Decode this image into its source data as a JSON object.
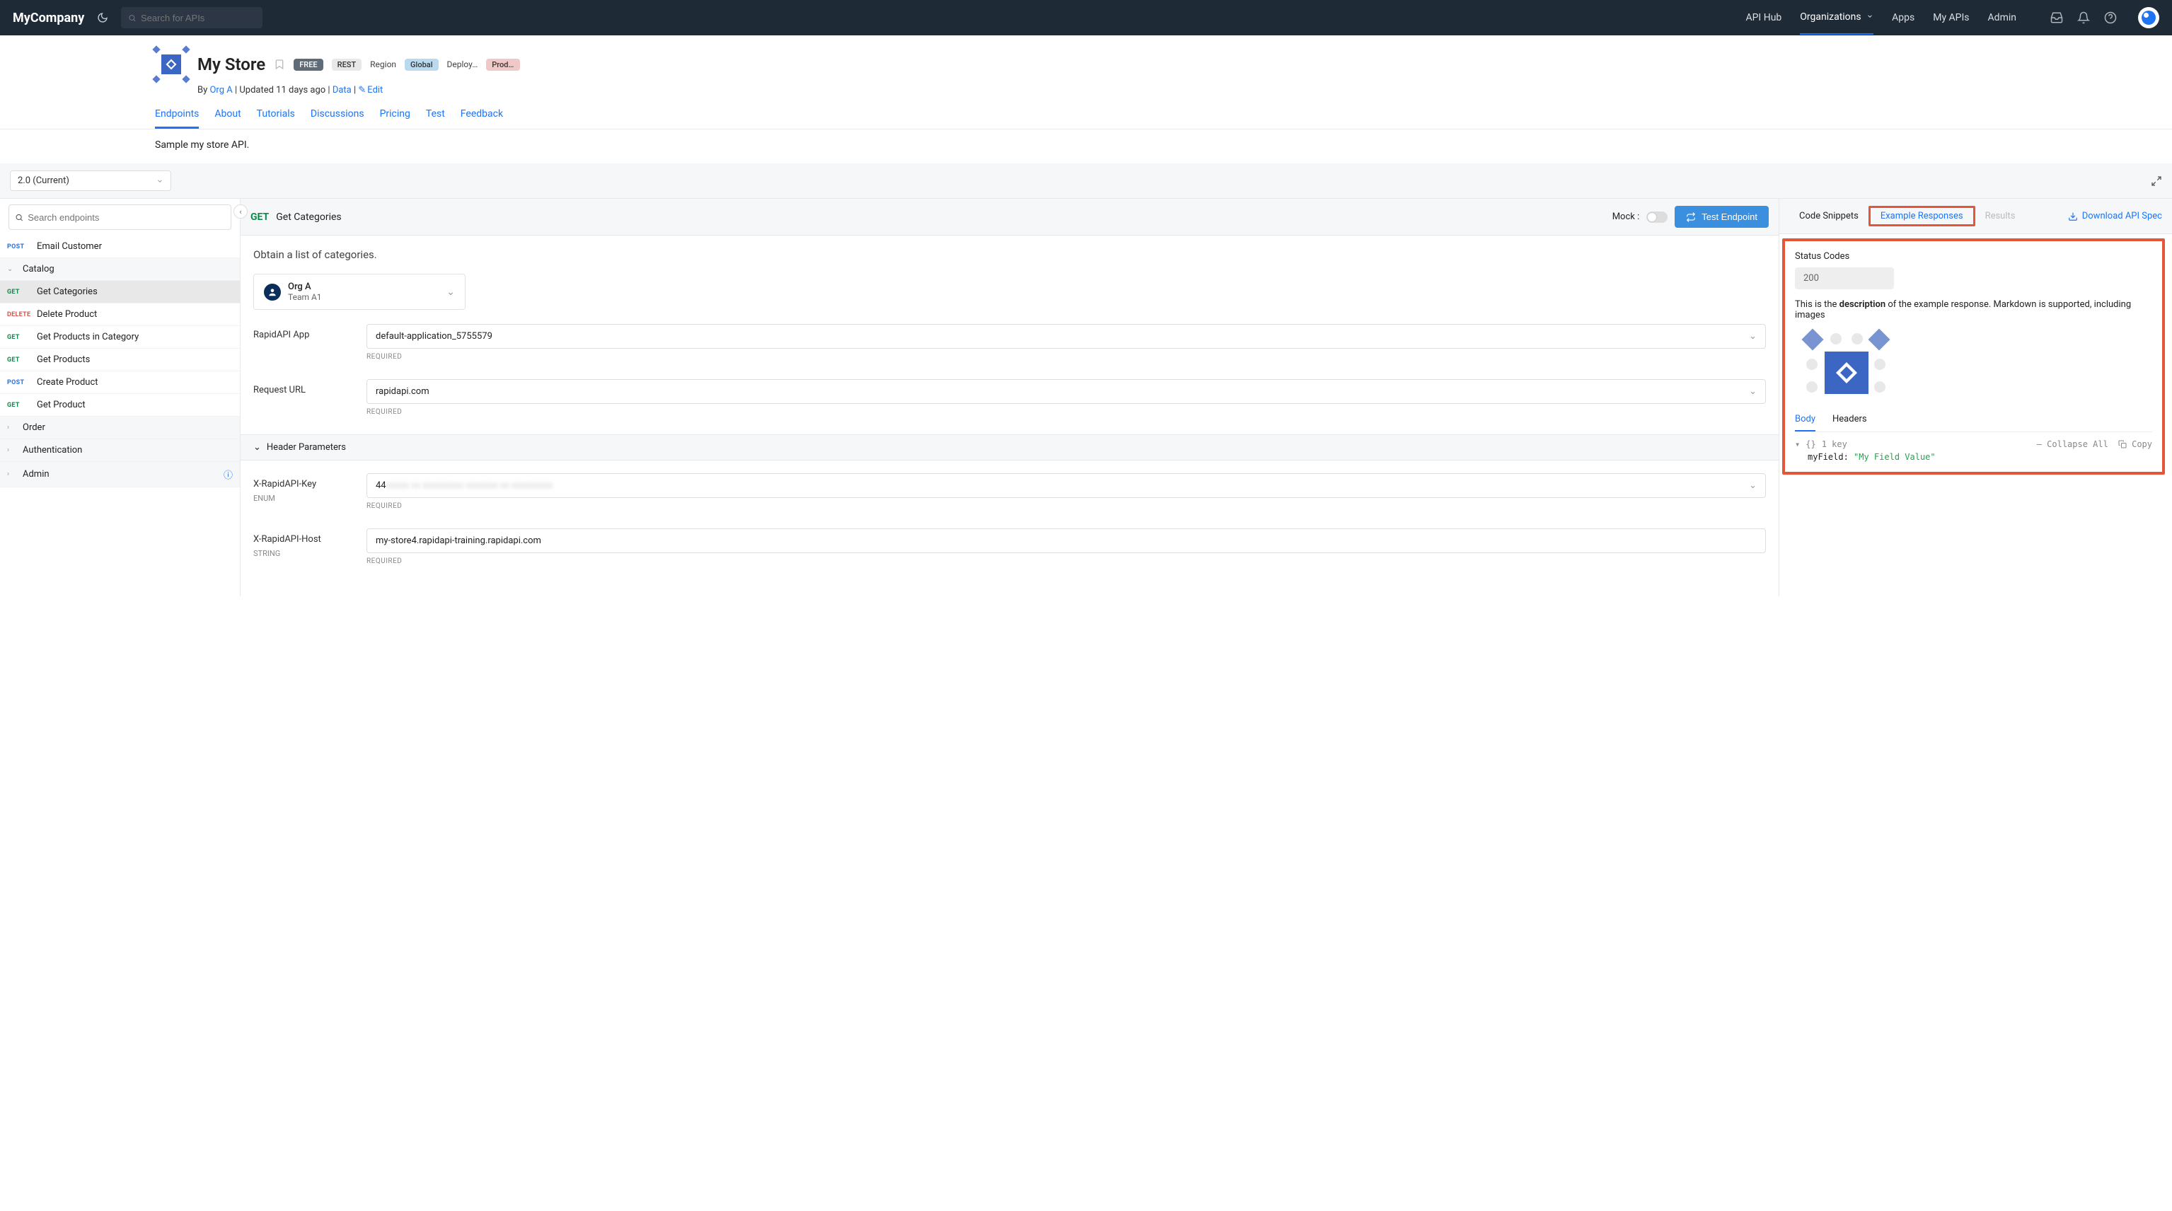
{
  "brand": "MyCompany",
  "search": {
    "placeholder": "Search for APIs"
  },
  "nav": {
    "api_hub": "API Hub",
    "orgs": "Organizations",
    "apps": "Apps",
    "my_apis": "My APIs",
    "admin": "Admin"
  },
  "api": {
    "title": "My Store",
    "badge_free": "FREE",
    "badge_rest": "REST",
    "region_label": "Region",
    "badge_global": "Global",
    "deploy_label": "Deploy…",
    "badge_prod": "Produc…",
    "by_prefix": "By ",
    "org": "Org A",
    "updated": " | Updated 11 days ago | ",
    "data": "Data",
    "edit": "Edit",
    "description": "Sample my store API."
  },
  "tabs": {
    "endpoints": "Endpoints",
    "about": "About",
    "tutorials": "Tutorials",
    "discussions": "Discussions",
    "pricing": "Pricing",
    "test": "Test",
    "feedback": "Feedback"
  },
  "toolbar": {
    "version": "2.0 (Current)"
  },
  "left": {
    "search_placeholder": "Search endpoints",
    "items": [
      {
        "method": "POST",
        "name": "Email Customer"
      },
      {
        "group": true,
        "name": "Catalog",
        "open": true
      },
      {
        "method": "GET",
        "name": "Get Categories",
        "active": true
      },
      {
        "method": "DELETE",
        "name": "Delete Product"
      },
      {
        "method": "GET",
        "name": "Get Products in Category"
      },
      {
        "method": "GET",
        "name": "Get Products"
      },
      {
        "method": "POST",
        "name": "Create Product"
      },
      {
        "method": "GET",
        "name": "Get Product"
      },
      {
        "group": true,
        "name": "Order"
      },
      {
        "group": true,
        "name": "Authentication"
      },
      {
        "group": true,
        "name": "Admin",
        "info": true
      }
    ]
  },
  "mid": {
    "method": "GET",
    "title": "Get Categories",
    "mock_label": "Mock :",
    "test_btn": "Test Endpoint",
    "desc": "Obtain a list of categories.",
    "team": {
      "org": "Org A",
      "team": "Team A1"
    },
    "app_label": "RapidAPI App",
    "app_value": "default-application_5755579",
    "url_label": "Request URL",
    "url_value": "rapidapi.com",
    "required": "REQUIRED",
    "header_section": "Header Parameters",
    "key_label": "X-RapidAPI-Key",
    "key_value": "44",
    "key_type": "ENUM",
    "host_label": "X-RapidAPI-Host",
    "host_value": "my-store4.rapidapi-training.rapidapi.com",
    "host_type": "STRING"
  },
  "right": {
    "tabs": {
      "code": "Code Snippets",
      "example": "Example Responses",
      "results": "Results"
    },
    "download": "Download API Spec",
    "status_h": "Status Codes",
    "status_code": "200",
    "desc_pre": "This is the ",
    "desc_b": "description",
    "desc_post": " of the example response. Markdown is supported, including images",
    "body_tab": "Body",
    "headers_tab": "Headers",
    "keys_label": "1 key",
    "collapse": "Collapse All",
    "copy": "Copy",
    "json_key": "myField:",
    "json_val": "\"My Field Value\""
  }
}
